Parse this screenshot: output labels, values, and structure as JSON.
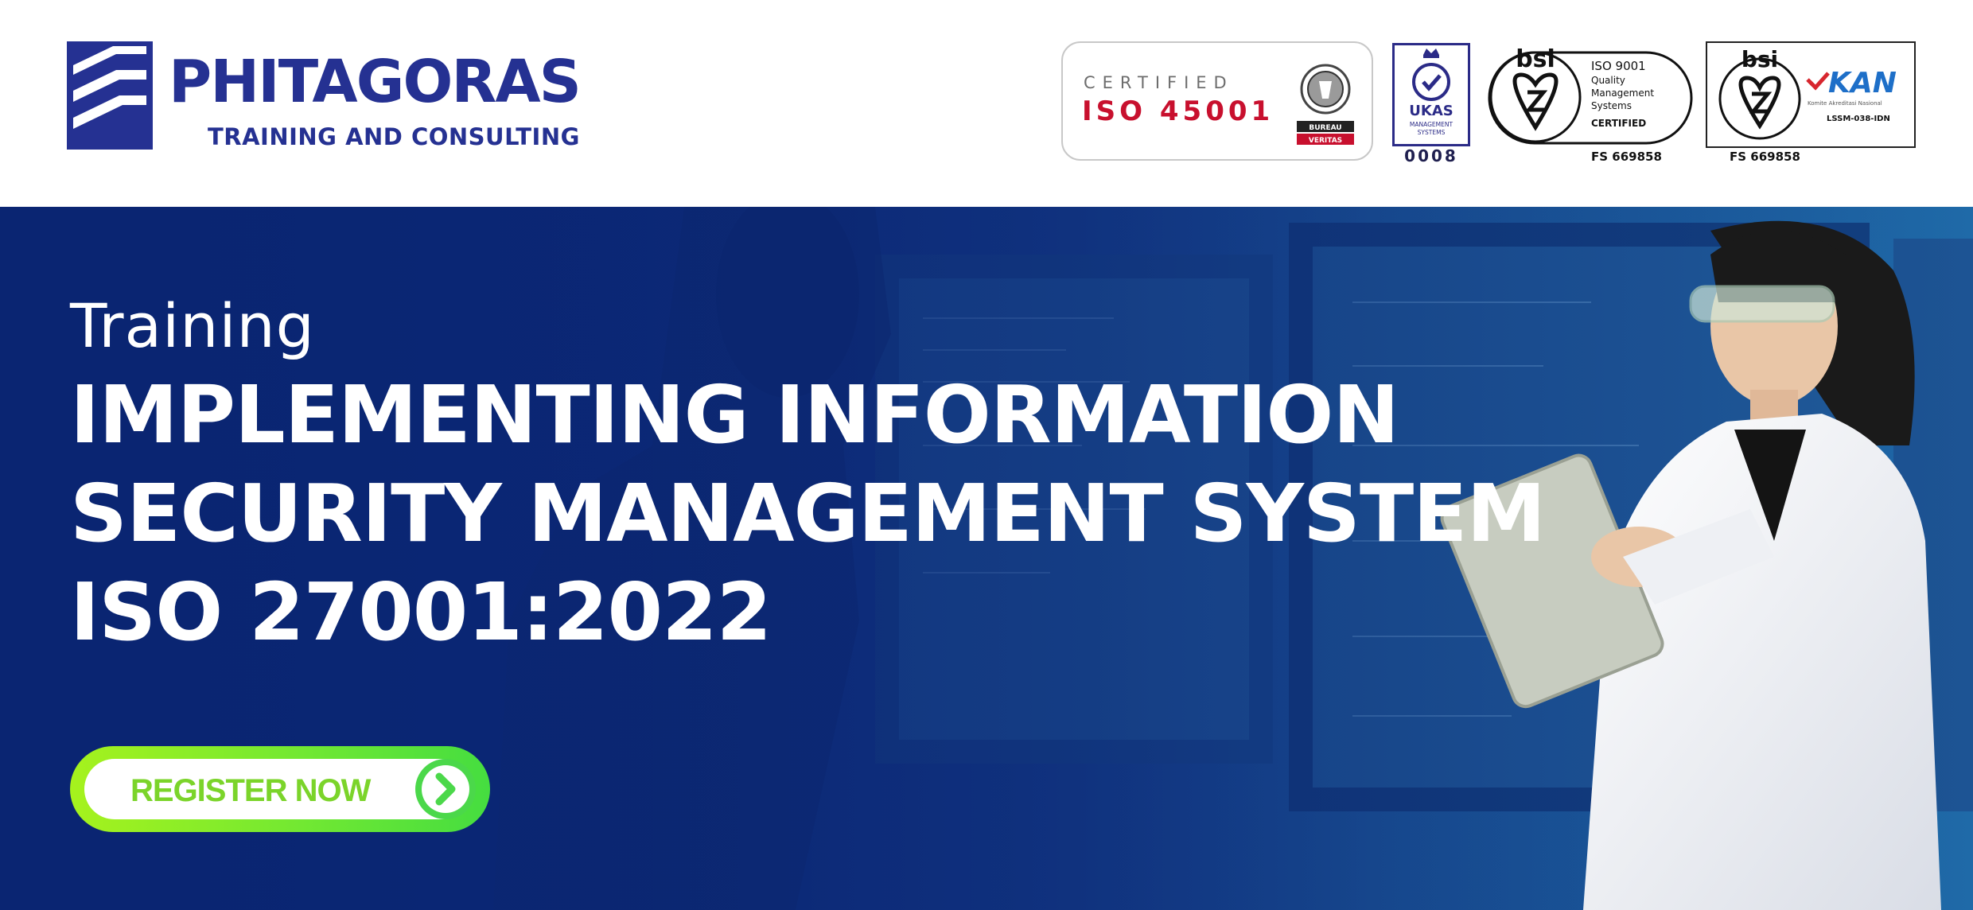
{
  "brand": {
    "name": "PHITAGORAS",
    "tagline": "TRAINING AND CONSULTING",
    "color": "#253192"
  },
  "certifications": {
    "iso_badge": {
      "certified_label": "CERTIFIED",
      "standard": "ISO 45001",
      "seal_text": "BUREAU VERITAS"
    },
    "ukas": {
      "seal_text": "UKAS MANAGEMENT SYSTEMS",
      "number": "0008"
    },
    "bsi_iso9001": {
      "brand": "bsi",
      "lines": [
        "ISO 9001",
        "Quality",
        "Management",
        "Systems",
        "CERTIFIED"
      ],
      "fs_number": "FS 669858"
    },
    "bsi_kan": {
      "brand": "bsi",
      "kan_logo": "KAN",
      "kan_subtitle": "Komite Akreditasi Nasional",
      "lssm": "LSSM-038-IDN",
      "fs_number": "FS 669858"
    }
  },
  "hero": {
    "kicker": "Training",
    "title_lines": [
      "IMPLEMENTING INFORMATION",
      "SECURITY MANAGEMENT SYSTEM",
      "ISO 27001:2022"
    ],
    "cta_label": "REGISTER NOW",
    "cta_icon": "chevron-right-icon"
  },
  "colors": {
    "banner_dark": "#0a2572",
    "cta_green": "#7bd42a",
    "iso_red": "#c8102e"
  }
}
